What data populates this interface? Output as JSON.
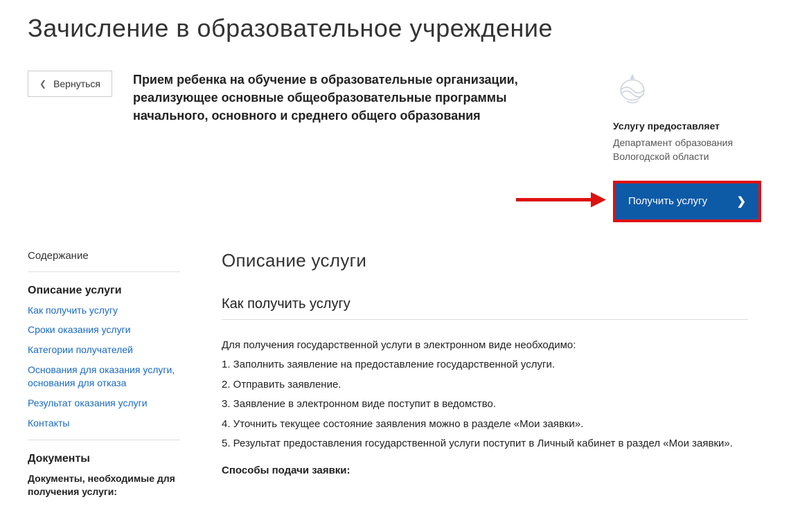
{
  "page_title": "Зачисление в образовательное учреждение",
  "back_button": "Вернуться",
  "subtitle": "Прием ребенка на обучение в образовательные организации, реализующее основные общеобразовательные программы начального, основного и среднего общего образования",
  "provider": {
    "label": "Услугу предоставляет",
    "name": "Департамент образования Вологодской области"
  },
  "cta": "Получить услугу",
  "sidebar": {
    "contents_label": "Содержание",
    "section_description": "Описание услуги",
    "links": [
      "Как получить услугу",
      "Сроки оказания услуги",
      "Категории получателей",
      "Основания для оказания услуги, основания для отказа",
      "Результат оказания услуги",
      "Контакты"
    ],
    "section_documents": "Документы",
    "documents_sub": "Документы, необходимые для получения услуги:"
  },
  "main": {
    "description_title": "Описание услуги",
    "how_title": "Как получить услугу",
    "intro": "Для получения государственной услуги в электронном виде необходимо:",
    "steps": [
      "1. Заполнить заявление на предоставление государственной услуги.",
      "2. Отправить заявление.",
      "3. Заявление в электронном виде поступит в ведомство.",
      "4. Уточнить текущее состояние заявления можно в разделе «Мои заявки».",
      "5. Результат предоставления государственной услуги поступит в Личный кабинет в раздел «Мои заявки»."
    ],
    "submit_methods_label": "Способы подачи заявки:"
  }
}
